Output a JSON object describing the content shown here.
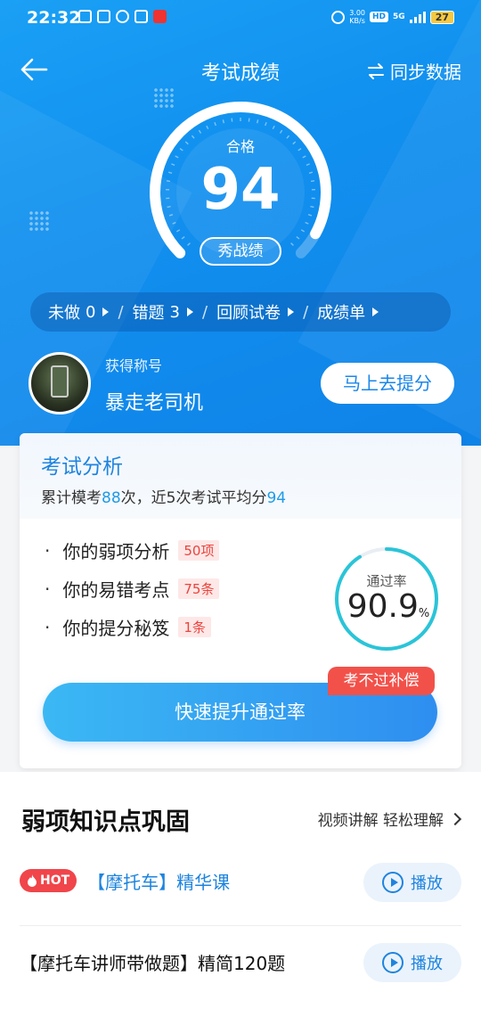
{
  "status_bar": {
    "time": "22:32",
    "net_speed_value": "3.00",
    "net_speed_unit": "KB/s",
    "hd": "HD",
    "signal": "5G",
    "battery": "27"
  },
  "nav": {
    "back_icon": "arrow-left-icon",
    "title": "考试成绩",
    "sync_icon": "swap-arrows-icon",
    "sync_label": "同步数据"
  },
  "score": {
    "label": "合格",
    "value": "94",
    "gauge_fraction": 0.94,
    "share_label": "秀战绩"
  },
  "pills": [
    {
      "label": "未做",
      "count": "0"
    },
    {
      "label": "错题",
      "count": "3"
    },
    {
      "label": "回顾试卷",
      "count": ""
    },
    {
      "label": "成绩单",
      "count": ""
    }
  ],
  "pill_sep": "/",
  "user": {
    "caption": "获得称号",
    "title": "暴走老司机",
    "boost_label": "马上去提分"
  },
  "analysis": {
    "title": "考试分析",
    "sub_prefix": "累计模考",
    "exam_count": "88",
    "sub_mid": "次，近5次考试平均分",
    "avg_score": "94",
    "bullet": "·",
    "items": [
      {
        "label": "你的弱项分析",
        "tag": "50项"
      },
      {
        "label": "你的易错考点",
        "tag": "75条"
      },
      {
        "label": "你的提分秘笈",
        "tag": "1条"
      }
    ],
    "pass_rate_label": "通过率",
    "pass_rate": "90.9",
    "pass_rate_unit": "%",
    "compensate_label": "考不过补偿",
    "cta_label": "快速提升通过率"
  },
  "weak": {
    "title": "弱项知识点巩固",
    "more_label": "视频讲解 轻松理解",
    "courses": [
      {
        "badge": "HOT",
        "name": "【摩托车】精华课",
        "play_label": "播放"
      },
      {
        "name": "【摩托车讲师带做题】精简120题",
        "play_label": "播放"
      }
    ]
  },
  "colors": {
    "primary": "#1190ef",
    "accent": "#1e84de",
    "danger": "#f2514a",
    "ring": "#2bc4d8"
  }
}
